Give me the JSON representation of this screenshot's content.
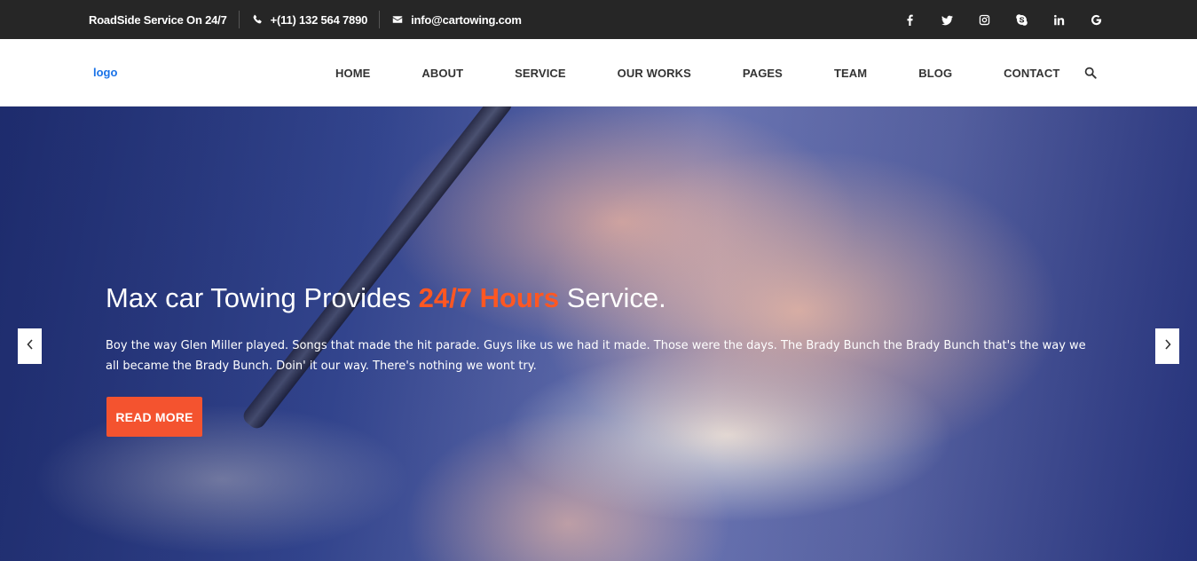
{
  "topbar": {
    "roadside": "RoadSide Service On 24/7",
    "phone": "+(11) 132 564 7890",
    "email": "info@cartowing.com",
    "social": [
      "facebook-icon",
      "twitter-icon",
      "instagram-icon",
      "skype-icon",
      "linkedin-icon",
      "google-icon"
    ]
  },
  "nav": {
    "logo": "logo",
    "items": [
      "HOME",
      "ABOUT",
      "SERVICE",
      "OUR WORKS",
      "PAGES",
      "TEAM",
      "BLOG",
      "CONTACT"
    ]
  },
  "hero": {
    "title_pre": "Max car Towing Provides ",
    "title_highlight": "24/7 Hours",
    "title_post": " Service.",
    "text": "Boy the way Glen Miller played. Songs that made the hit parade. Guys like us we had it made. Those were the days. The Brady Bunch the Brady Bunch that's the way we all became the Brady Bunch. Doin' it our way. There's nothing we wont try.",
    "button": "READ MORE"
  },
  "colors": {
    "accent": "#f4532f",
    "topbar_bg": "#262626",
    "logo": "#1a73e8"
  }
}
